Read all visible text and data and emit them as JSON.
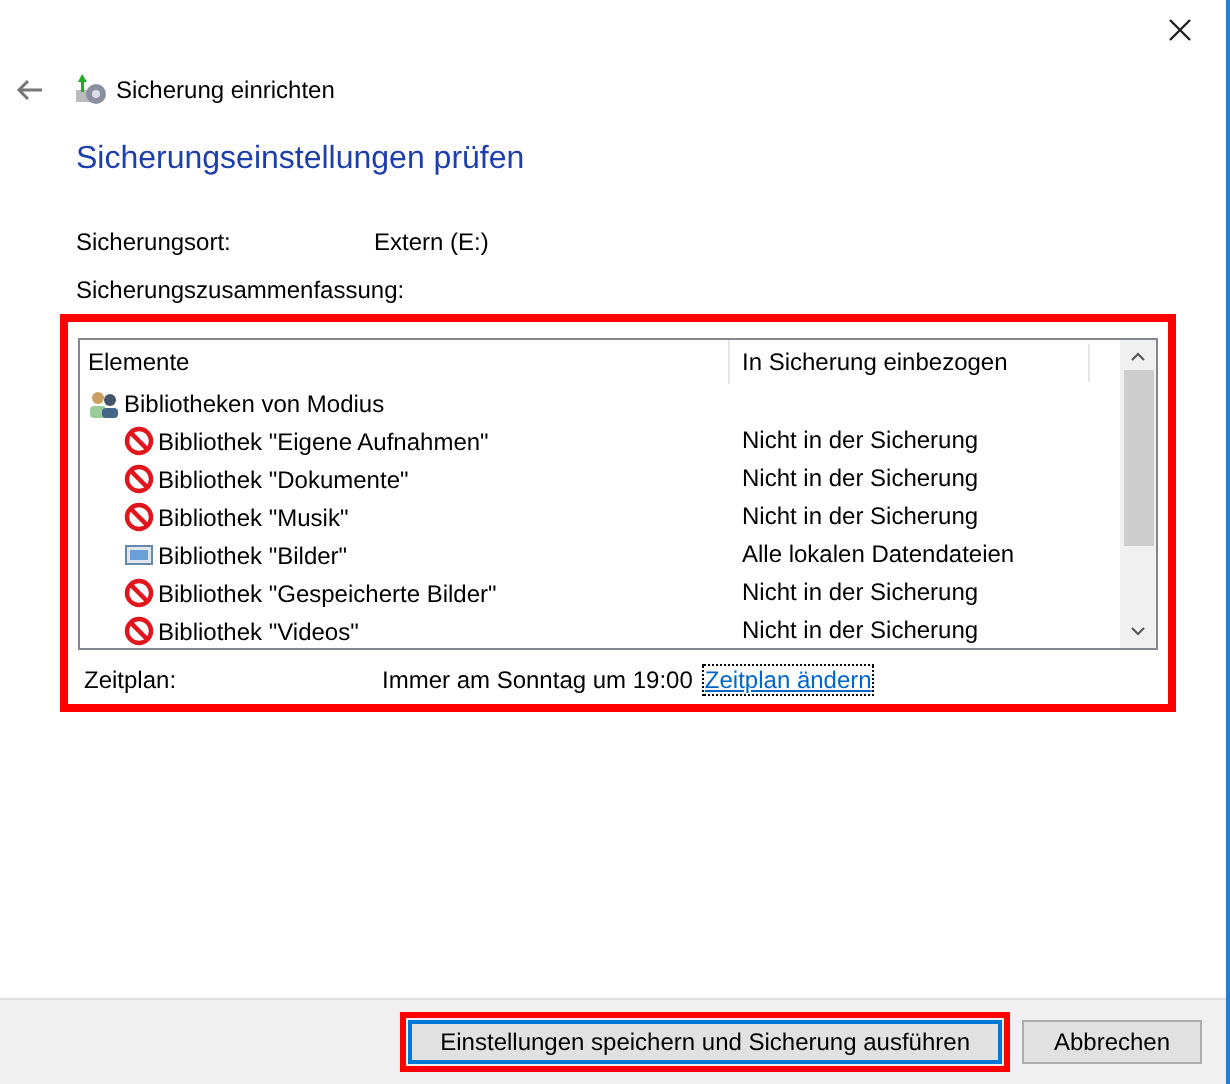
{
  "window": {
    "title": "Sicherung einrichten"
  },
  "heading": "Sicherungseinstellungen prüfen",
  "location": {
    "label": "Sicherungsort:",
    "value": "Extern (E:)"
  },
  "summary": {
    "label": "Sicherungszusammenfassung:",
    "columns": [
      "Elemente",
      "In Sicherung einbezogen"
    ],
    "groups": [
      {
        "label": "Bibliotheken von Modius",
        "children": [
          {
            "label": "Bibliothek \"Eigene Aufnahmen\"",
            "included": false,
            "status": "Nicht in der Sicherung"
          },
          {
            "label": "Bibliothek \"Dokumente\"",
            "included": false,
            "status": "Nicht in der Sicherung"
          },
          {
            "label": "Bibliothek \"Musik\"",
            "included": false,
            "status": "Nicht in der Sicherung"
          },
          {
            "label": "Bibliothek \"Bilder\"",
            "included": true,
            "status": "Alle lokalen Datendateien"
          },
          {
            "label": "Bibliothek \"Gespeicherte Bilder\"",
            "included": false,
            "status": "Nicht in der Sicherung"
          },
          {
            "label": "Bibliothek \"Videos\"",
            "included": false,
            "status": "Nicht in der Sicherung"
          }
        ]
      }
    ]
  },
  "schedule": {
    "label": "Zeitplan:",
    "value": "Immer am Sonntag um 19:00",
    "link": "Zeitplan ändern"
  },
  "buttons": [
    {
      "label": "Einstellungen speichern und Sicherung ausführen",
      "default": true,
      "highlighted": true
    },
    {
      "label": "Abbrechen",
      "default": false,
      "highlighted": false
    }
  ],
  "highlights": {
    "summary": true
  }
}
